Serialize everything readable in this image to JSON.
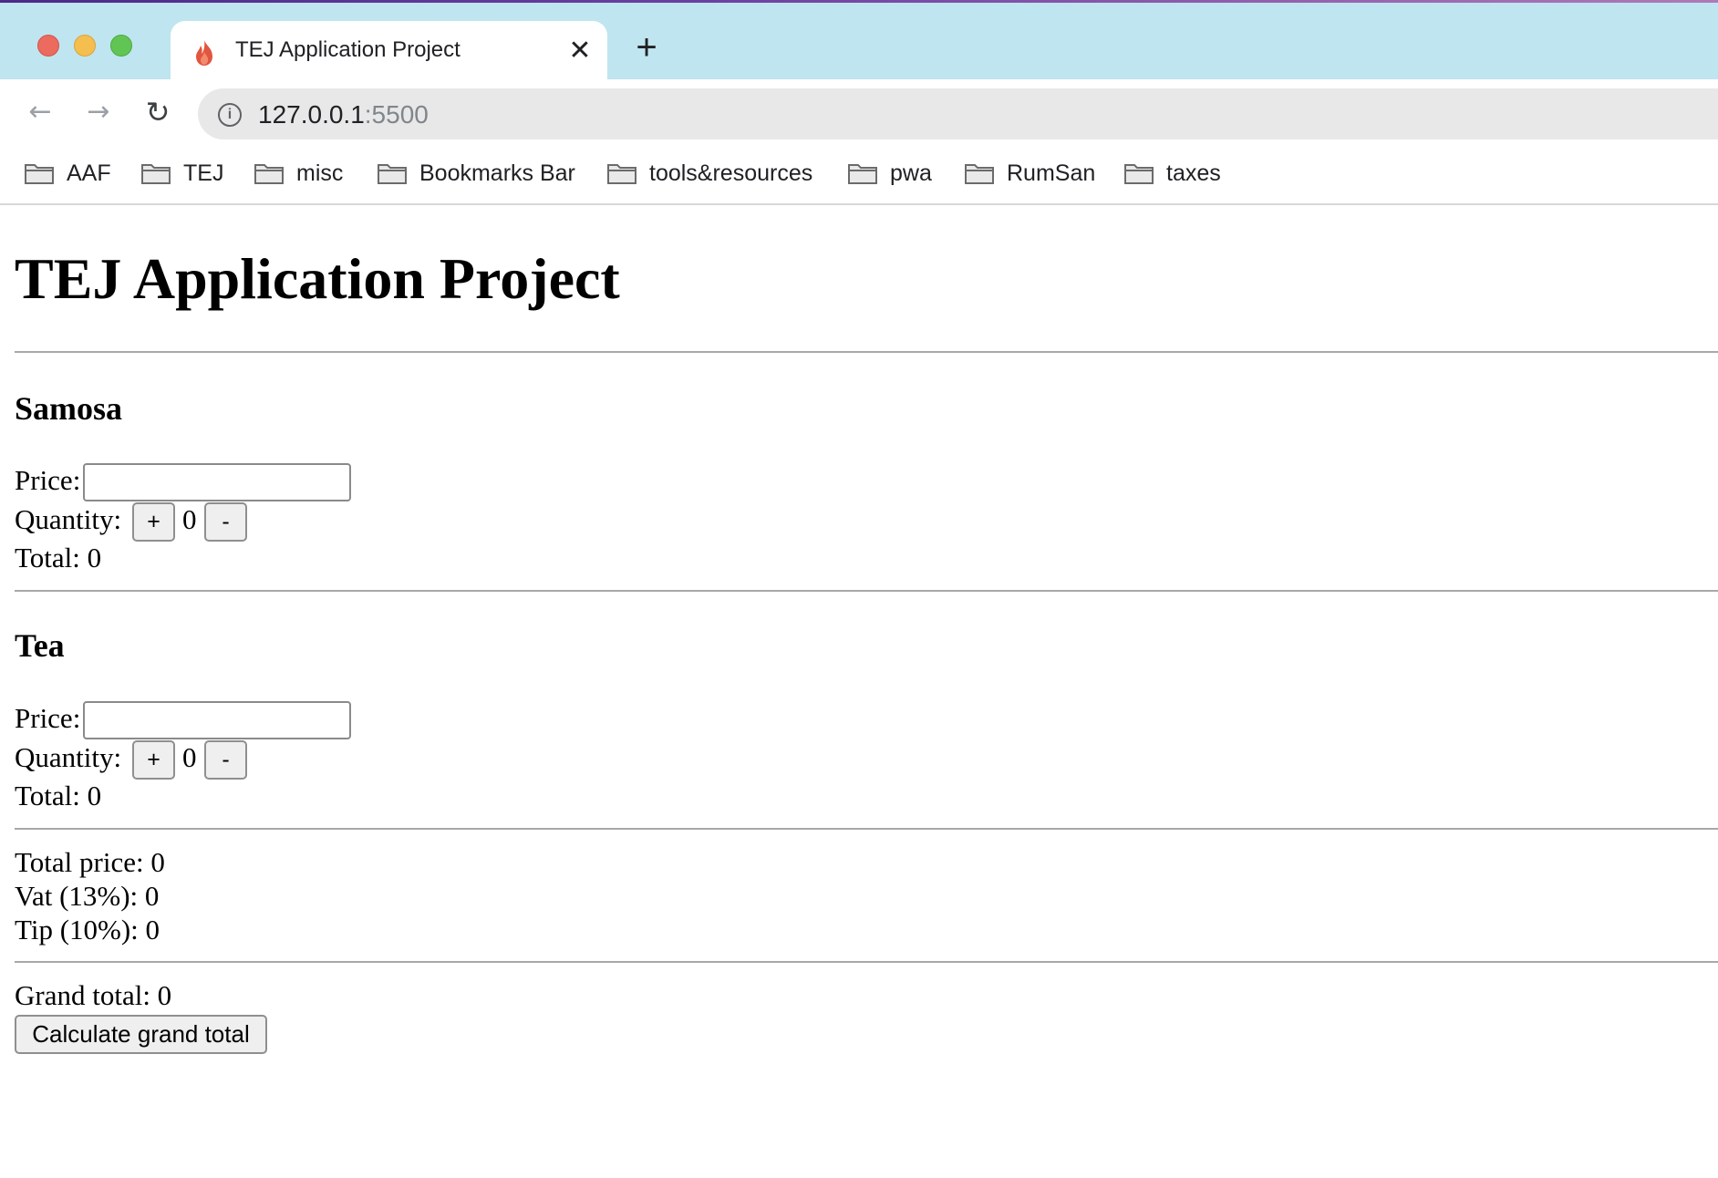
{
  "browser": {
    "tab": {
      "title": "TEJ Application Project",
      "close_glyph": "✕"
    },
    "new_tab_glyph": "+",
    "nav": {
      "back_glyph": "←",
      "forward_glyph": "→",
      "reload_glyph": "↻"
    },
    "omnibox": {
      "info_glyph": "i",
      "url_host": "127.0.0.1",
      "url_port": ":5500"
    },
    "bookmarks": [
      {
        "label": "AAF"
      },
      {
        "label": "TEJ"
      },
      {
        "label": "misc"
      },
      {
        "label": "Bookmarks Bar"
      },
      {
        "label": "tools&resources"
      },
      {
        "label": "pwa"
      },
      {
        "label": "RumSan"
      },
      {
        "label": "taxes"
      }
    ]
  },
  "page": {
    "title": "TEJ Application Project",
    "items": [
      {
        "name": "Samosa",
        "price_label": "Price:",
        "price_value": "",
        "quantity_label": "Quantity:",
        "plus_label": "+",
        "minus_label": "-",
        "quantity": "0",
        "total_label": "Total: 0"
      },
      {
        "name": "Tea",
        "price_label": "Price:",
        "price_value": "",
        "quantity_label": "Quantity:",
        "plus_label": "+",
        "minus_label": "-",
        "quantity": "0",
        "total_label": "Total: 0"
      }
    ],
    "summary": {
      "total_price": "Total price: 0",
      "vat": "Vat (13%): 0",
      "tip": "Tip (10%): 0"
    },
    "grand_total": "Grand total: 0",
    "calculate_button": "Calculate grand total"
  }
}
